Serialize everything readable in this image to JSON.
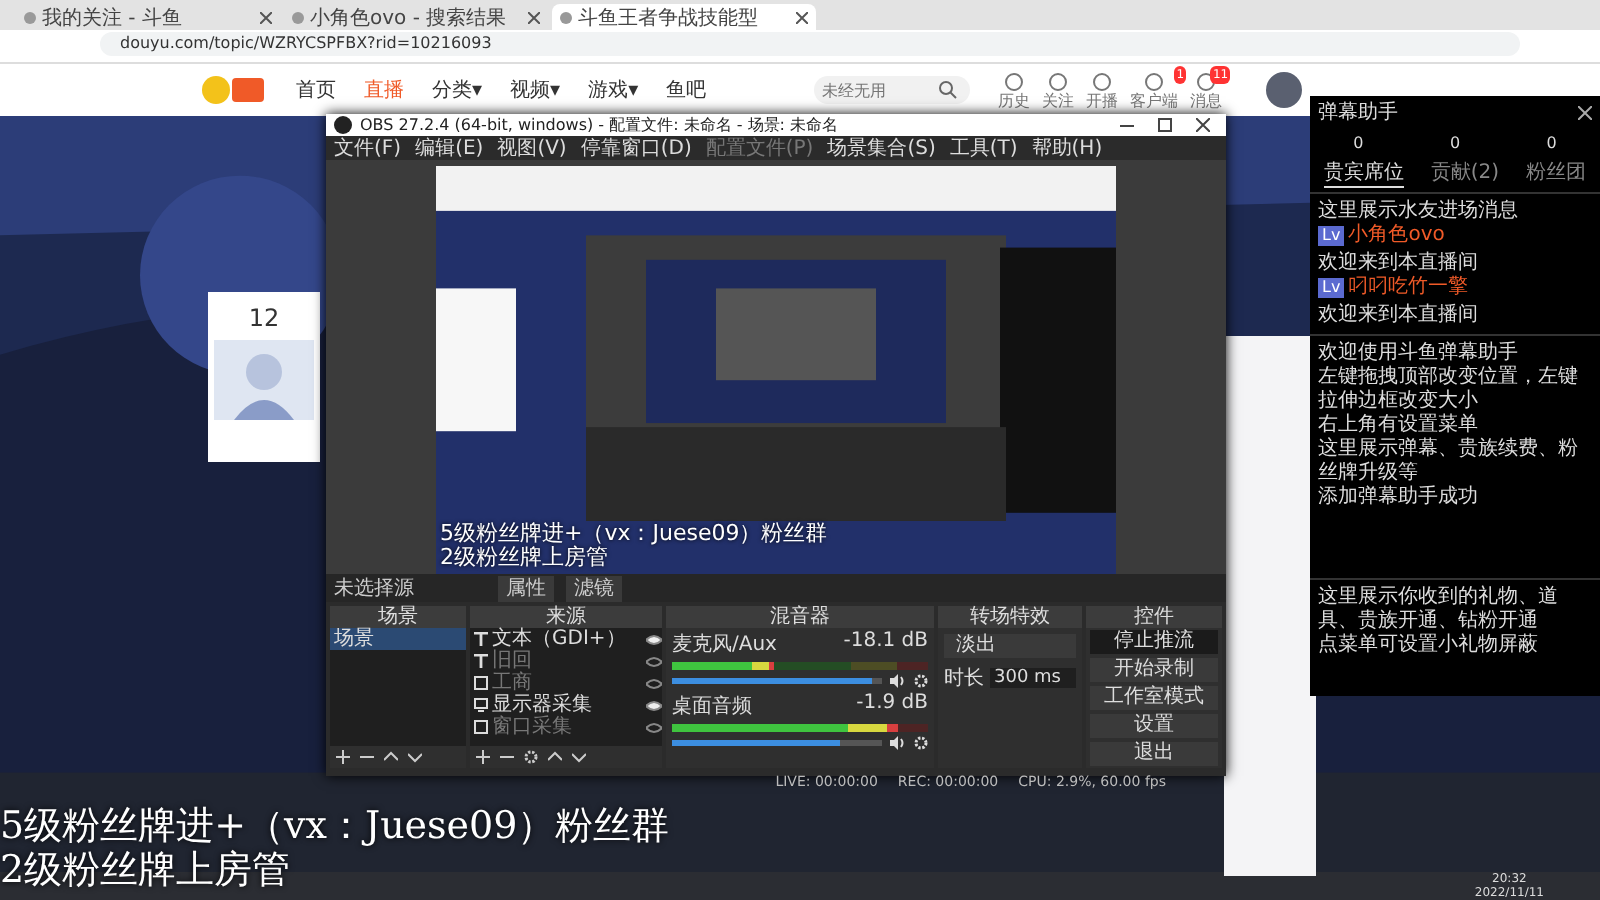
{
  "browser": {
    "tabs": [
      {
        "title": "我的关注 - 斗鱼",
        "selected": false
      },
      {
        "title": "小角色ovo - 搜索结果",
        "selected": false
      },
      {
        "title": "斗鱼王者争战技能型",
        "selected": true
      }
    ],
    "url": "douyu.com/topic/WZRYCSPFBX?rid=10216093"
  },
  "site": {
    "nav": [
      {
        "label": "首页",
        "selected": false
      },
      {
        "label": "直播",
        "selected": true
      },
      {
        "label": "分类▾",
        "selected": false
      },
      {
        "label": "视频▾",
        "selected": false
      },
      {
        "label": "游戏▾",
        "selected": false
      },
      {
        "label": "鱼吧",
        "selected": false
      }
    ],
    "search": {
      "placeholder": "未经无用"
    },
    "tools": [
      {
        "label": "历史"
      },
      {
        "label": "关注"
      },
      {
        "label": "开播"
      },
      {
        "label": "客户端",
        "badge": "1"
      },
      {
        "label": "消息",
        "badge": "11"
      }
    ],
    "side_count": "12"
  },
  "obs": {
    "title": "OBS 27.2.4 (64-bit, windows) - 配置文件: 未命名 - 场景: 未命名",
    "menu": [
      {
        "label": "文件(F)",
        "disabled": false
      },
      {
        "label": "编辑(E)",
        "disabled": false
      },
      {
        "label": "视图(V)",
        "disabled": false
      },
      {
        "label": "停靠窗口(D)",
        "disabled": false
      },
      {
        "label": "配置文件(P)",
        "disabled": true
      },
      {
        "label": "场景集合(S)",
        "disabled": false
      },
      {
        "label": "工具(T)",
        "disabled": false
      },
      {
        "label": "帮助(H)",
        "disabled": false
      }
    ],
    "preview_captions": [
      "5级粉丝牌进+（vx：Juese09）粉丝群",
      "2级粉丝牌上房管"
    ],
    "source_bar": {
      "label": "未选择源",
      "buttons": [
        "属性",
        "滤镜"
      ]
    },
    "scenes": {
      "title": "场景",
      "items": [
        {
          "label": "场景",
          "selected": true
        }
      ]
    },
    "sources": {
      "title": "来源",
      "items": [
        {
          "kind": "text",
          "label": "文本（GDI+）",
          "visible": true
        },
        {
          "kind": "text",
          "label": "旧回",
          "visible": false
        },
        {
          "kind": "window",
          "label": "工商",
          "visible": false
        },
        {
          "kind": "monitor",
          "label": "显示器采集",
          "visible": true
        },
        {
          "kind": "window",
          "label": "窗口采集",
          "visible": false
        }
      ]
    },
    "mixer": {
      "title": "混音器",
      "channels": [
        {
          "name": "麦克风/Aux",
          "reading": "-18.1 dB",
          "meter": {
            "level": 0.4
          },
          "fader": {
            "level": 0.95
          }
        },
        {
          "name": "桌面音频",
          "reading": "-1.9 dB",
          "meter": {
            "level": 0.88
          },
          "fader": {
            "level": 0.8
          }
        }
      ]
    },
    "transitions": {
      "title": "转场特效",
      "select": "淡出",
      "duration_label": "时长",
      "duration": "300 ms"
    },
    "controls": {
      "title": "控件",
      "buttons": [
        {
          "label": "停止推流",
          "active": true
        },
        {
          "label": "开始录制",
          "active": false
        },
        {
          "label": "工作室模式",
          "active": false
        },
        {
          "label": "设置",
          "active": false
        },
        {
          "label": "退出",
          "active": false
        }
      ]
    },
    "status": {
      "live": "LIVE: 00:00:00",
      "rec": "REC: 00:00:00",
      "cpu": "CPU: 2.9%, 60.00 fps"
    }
  },
  "danmaku": {
    "title": "弹幕助手",
    "stats": [
      "0",
      "0",
      "0"
    ],
    "tabs": [
      {
        "label": "贵宾席位",
        "selected": true
      },
      {
        "label": "贡献(2)",
        "selected": false
      },
      {
        "label": "粉丝团",
        "selected": false
      }
    ],
    "entry_title": "这里展示水友进场消息",
    "entries": [
      {
        "level": "Lv",
        "name": "小角色ovo",
        "text": "欢迎来到本直播间",
        "color": "#f05a28"
      },
      {
        "level": "Lv",
        "name": "叼叼吃竹一擎",
        "text": "欢迎来到本直播间",
        "color": "#f05a28"
      }
    ],
    "notices": [
      "欢迎使用斗鱼弹幕助手",
      "左键拖拽顶部改变位置，左键拉伸边框改变大小",
      "右上角有设置菜单",
      "这里展示弹幕、贵族续费、粉丝牌升级等",
      "添加弹幕助手成功"
    ],
    "gift_notes": [
      "这里展示你收到的礼物、道具、贵族开通、钻粉开通",
      "点菜单可设置小礼物屏蔽"
    ]
  },
  "captions": [
    "5级粉丝牌进+（vx：Juese09）粉丝群",
    "2级粉丝牌上房管"
  ],
  "taskbar": {
    "time": "20:32",
    "date": "2022/11/11"
  }
}
